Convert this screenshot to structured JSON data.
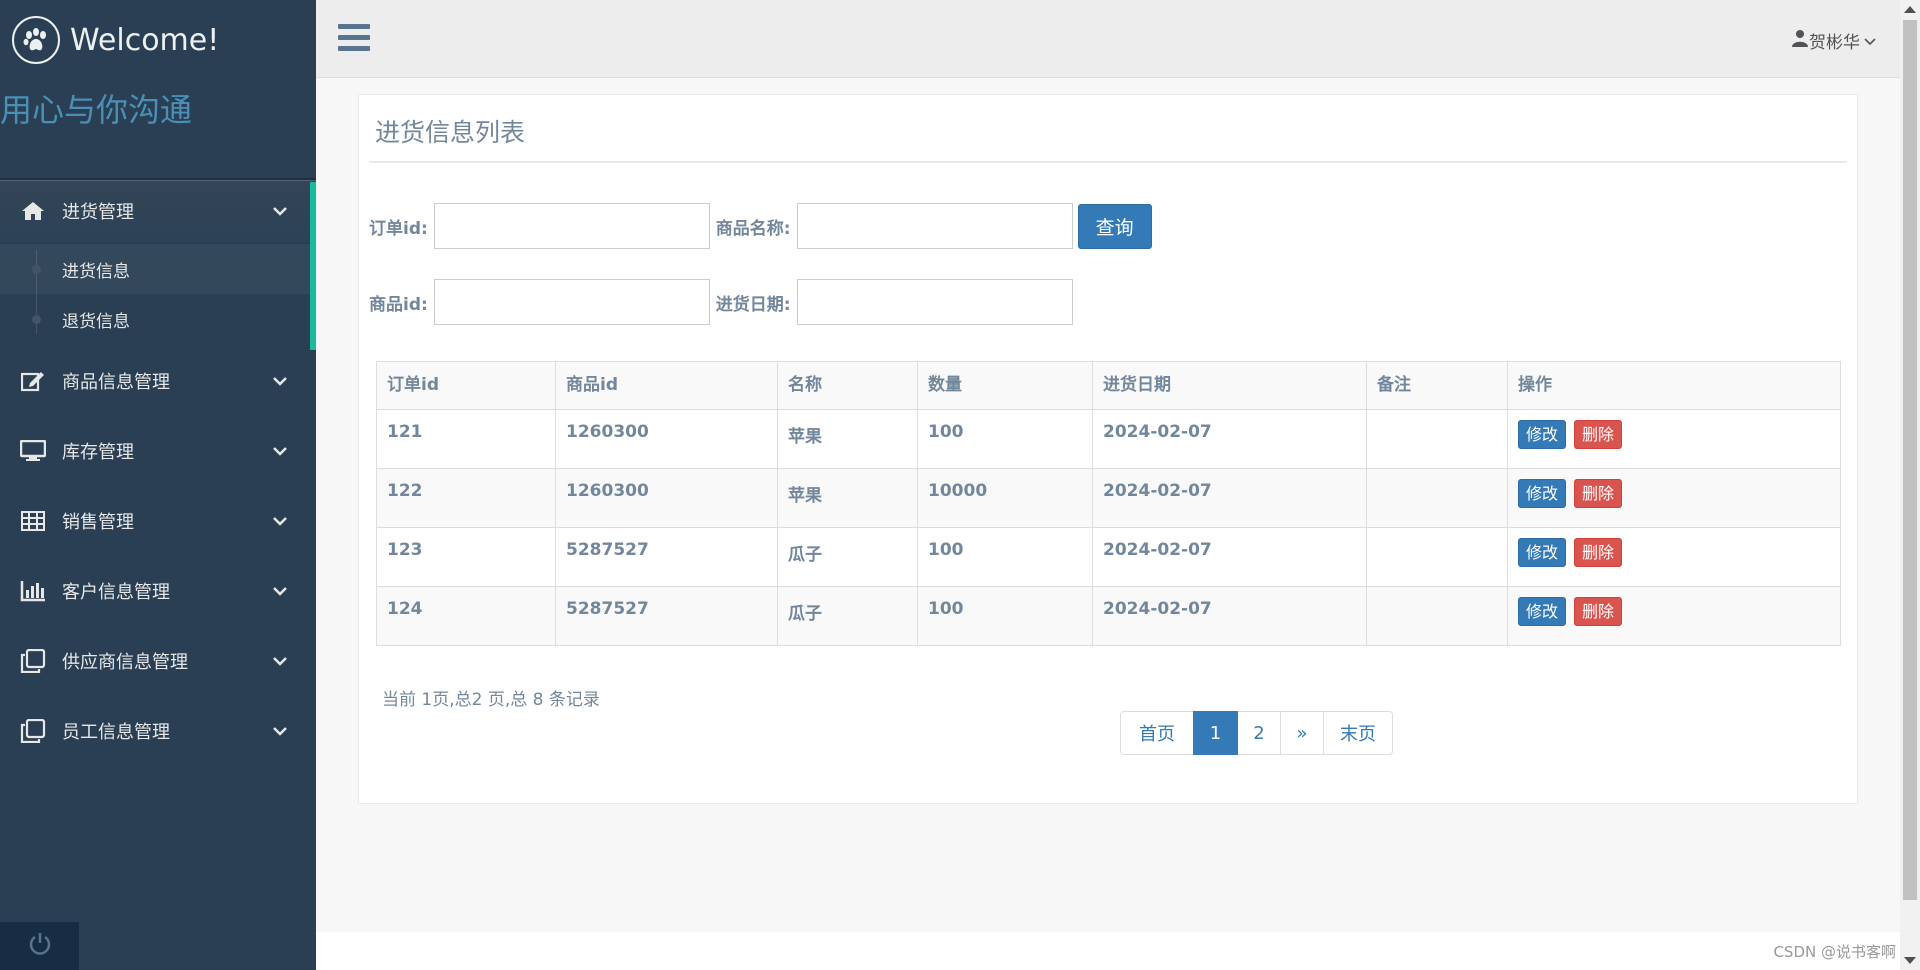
{
  "brand": {
    "title": "Welcome!",
    "tagline": "用心与你沟通"
  },
  "menu": {
    "items": [
      {
        "label": "进货管理",
        "icon": "home-icon"
      },
      {
        "label": "商品信息管理",
        "icon": "edit-icon"
      },
      {
        "label": "库存管理",
        "icon": "desktop-icon"
      },
      {
        "label": "销售管理",
        "icon": "table-icon"
      },
      {
        "label": "客户信息管理",
        "icon": "bar-chart-icon"
      },
      {
        "label": "供应商信息管理",
        "icon": "clone-icon"
      },
      {
        "label": "员工信息管理",
        "icon": "clone-icon"
      }
    ],
    "submenu": [
      {
        "label": "进货信息"
      },
      {
        "label": "退货信息"
      }
    ]
  },
  "header": {
    "user": "贺彬华"
  },
  "panel": {
    "title": "进货信息列表",
    "form": {
      "order_id_label": "订单id:",
      "product_name_label": "商品名称:",
      "query_button": "查询",
      "product_id_label": "商品id:",
      "purchase_date_label": "进货日期:",
      "order_id_value": "",
      "product_name_value": "",
      "product_id_value": "",
      "purchase_date_value": ""
    },
    "table": {
      "headers": [
        "订单id",
        "商品id",
        "名称",
        "数量",
        "进货日期",
        "备注",
        "操作"
      ],
      "rows": [
        [
          "121",
          "1260300",
          "苹果",
          "100",
          "2024-02-07",
          ""
        ],
        [
          "122",
          "1260300",
          "苹果",
          "10000",
          "2024-02-07",
          ""
        ],
        [
          "123",
          "5287527",
          "瓜子",
          "100",
          "2024-02-07",
          ""
        ],
        [
          "124",
          "5287527",
          "瓜子",
          "100",
          "2024-02-07",
          ""
        ]
      ],
      "edit_label": "修改",
      "delete_label": "删除"
    },
    "summary": "当前 1页,总2 页,总 8 条记录",
    "pagination": {
      "first": "首页",
      "pages": [
        "1",
        "2"
      ],
      "next": "»",
      "last": "末页",
      "current": "1"
    }
  },
  "watermark": "CSDN @说书客啊",
  "colors": {
    "sidebar": "#2a3f54",
    "accent": "#1abb9c",
    "primary": "#337ab7",
    "danger": "#d9534f"
  }
}
